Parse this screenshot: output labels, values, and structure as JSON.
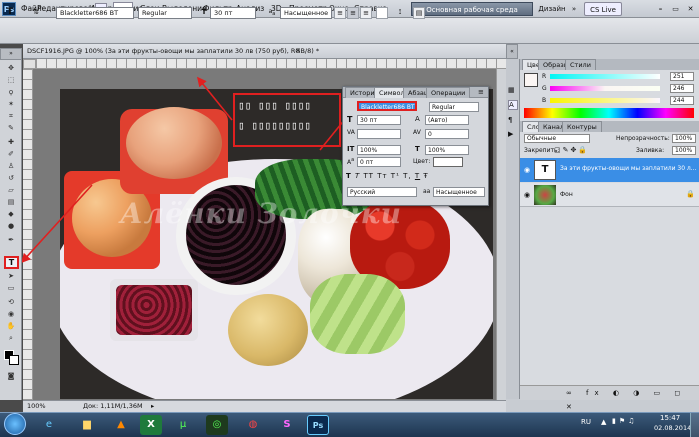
{
  "menubar": {
    "logo": "Ps",
    "items": [
      "Файл",
      "Редактирование",
      "Изображение",
      "Слои",
      "Выделение",
      "Фильтр",
      "Анализ",
      "3D",
      "Просмотр",
      "Окно",
      "Справка"
    ],
    "zoom": "100%",
    "workspace": "Основная рабочая среда",
    "design": "Дизайн",
    "cslive": "CS Live"
  },
  "options": {
    "font_family": "Blackletter686 BT",
    "font_style": "Regular",
    "font_size": "30 пт",
    "antialias": "Насыщенное"
  },
  "document": {
    "tab_title": "DSCF1916.JPG @ 100% (За эти фрукты-овощи мы заплатили 30 лв (750 руб), RGB/8) *",
    "status_zoom": "100%",
    "status_doc": "Док: 1,11M/1,36M",
    "overlay_text_line1": "▯▯ ▯▯▯ ▯▯▯▯",
    "overlay_text_line2": "▯ ▯▯▯▯▯▯▯▯▯",
    "watermark": "Алёнки Золочки"
  },
  "character_panel": {
    "tabs": [
      "История",
      "Символ",
      "Абзац",
      "Операции"
    ],
    "font_family": "Blackletter686 BT",
    "font_style": "Regular",
    "size": "30 пт",
    "leading": "(Авто)",
    "kerning": "0",
    "scale_v": "100%",
    "scale_h": "100%",
    "baseline": "0 пт",
    "color_label": "Цвет:",
    "language": "Русский",
    "aa_label": "aa",
    "antialias": "Насыщенное",
    "style_buttons": [
      "T",
      "T",
      "TT",
      "Tт",
      "T¹",
      "T,",
      "T",
      "Ŧ"
    ]
  },
  "color_panel": {
    "tabs": [
      "Цвет",
      "Образцы",
      "Стили"
    ],
    "r_label": "R",
    "g_label": "G",
    "b_label": "B",
    "r": "251",
    "g": "246",
    "b": "244"
  },
  "layers_panel": {
    "tabs": [
      "Слои",
      "Каналы",
      "Контуры"
    ],
    "blend_mode": "Обычные",
    "opacity_label": "Непрозрачность:",
    "opacity": "100%",
    "lock_label": "Закрепить:",
    "fill_label": "Заливка:",
    "fill": "100%",
    "layers": [
      {
        "name": "За эти фрукты-овощи мы заплатили 30 л...",
        "thumb": "T",
        "selected": true
      },
      {
        "name": "Фон",
        "thumb": "",
        "selected": false
      }
    ]
  },
  "taskbar": {
    "lang": "RU",
    "time": "15:47",
    "date": "02.08.2014"
  },
  "colors": {
    "accent": "#3b8fe0",
    "highlight_red": "#e02020",
    "layer_selected": "#3a8ee6"
  }
}
